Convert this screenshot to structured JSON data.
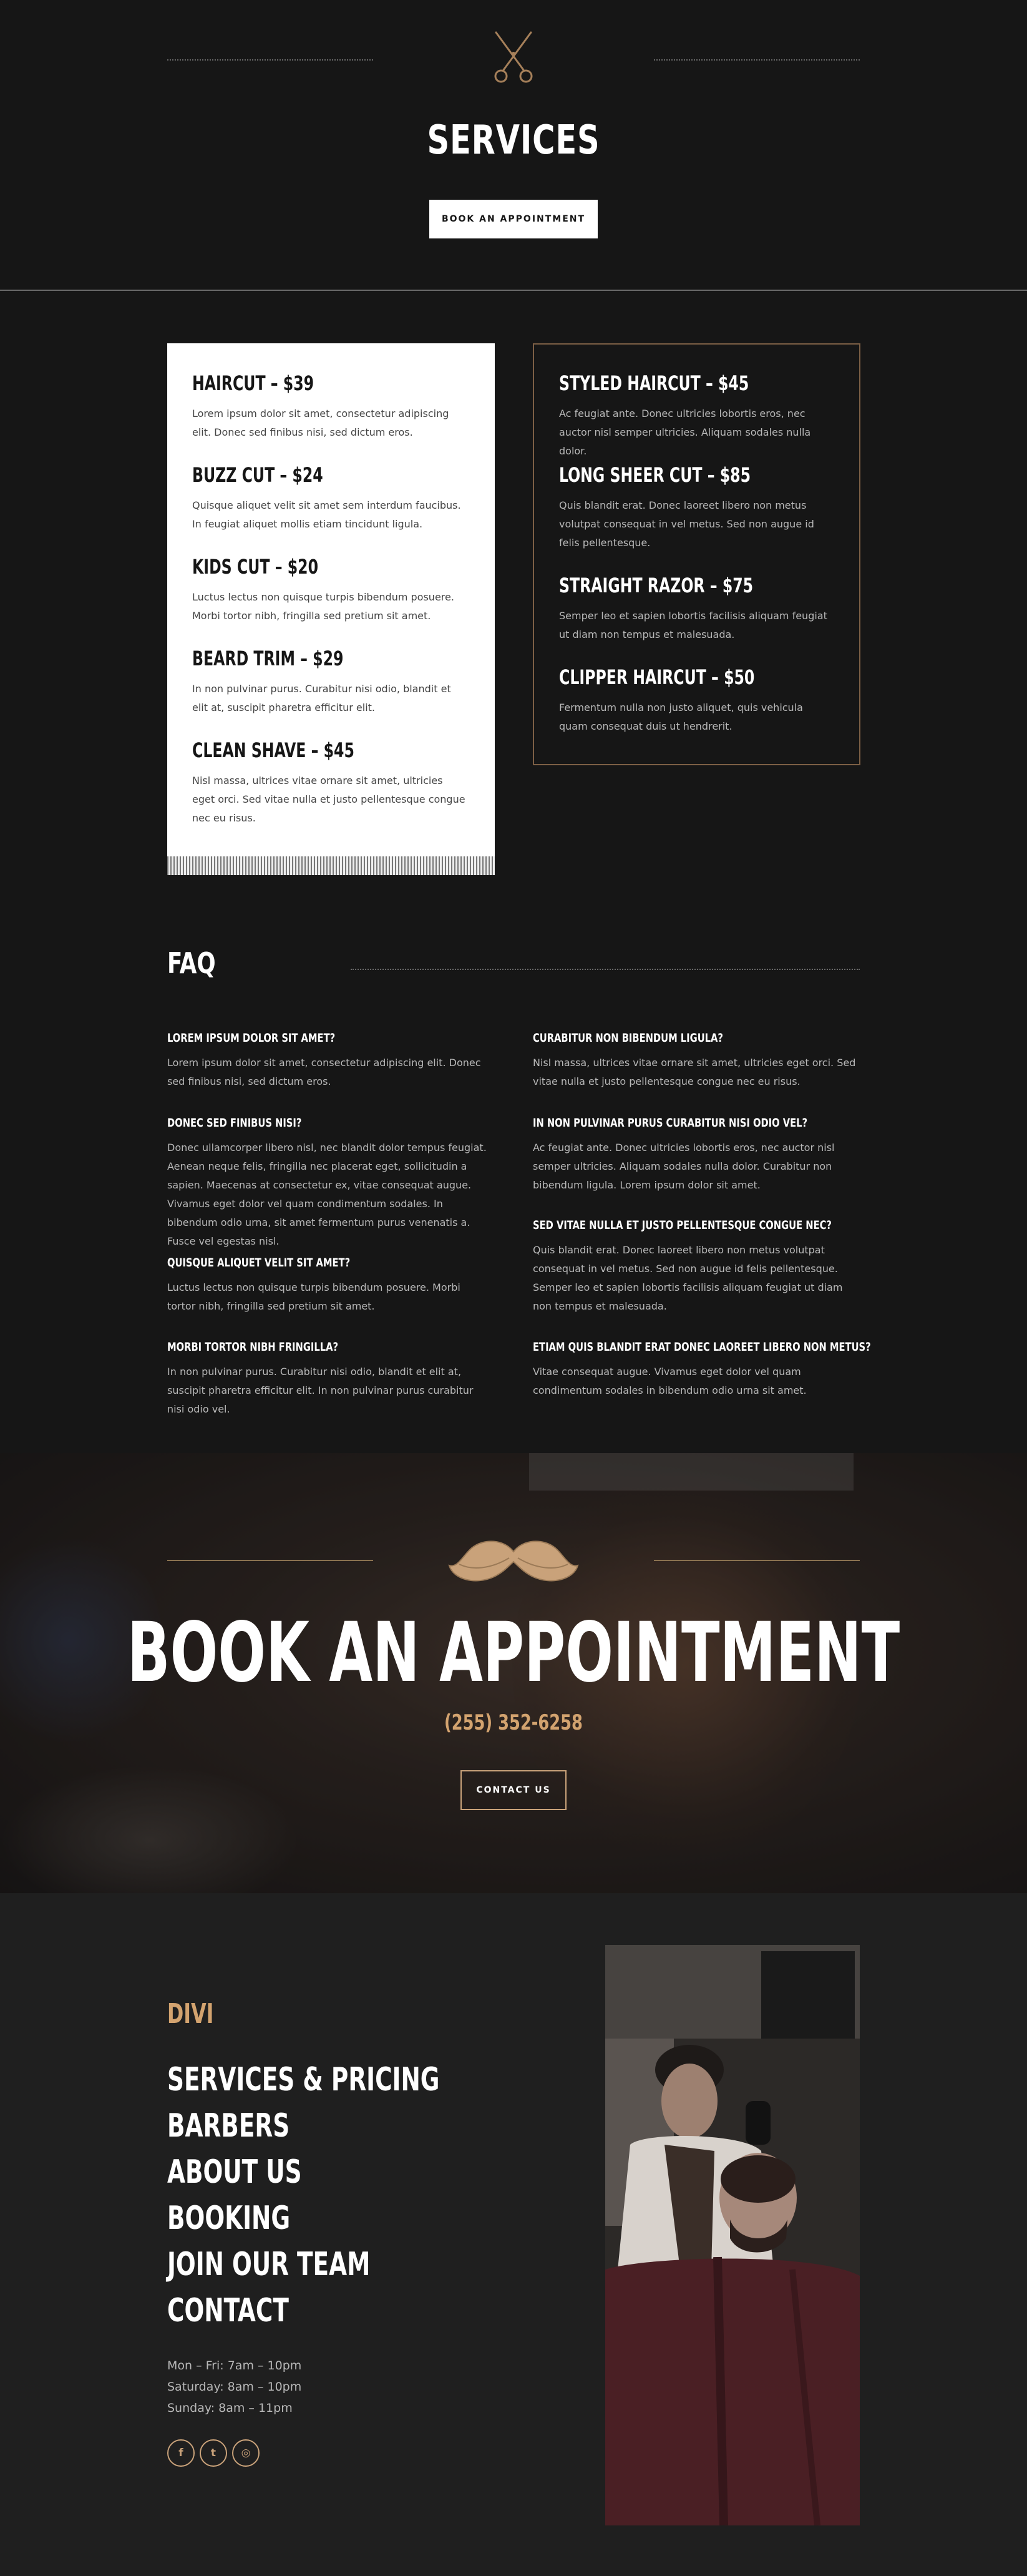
{
  "hero": {
    "title": "SERVICES",
    "button_label": "BOOK AN APPOINTMENT",
    "icon": "scissors-icon"
  },
  "services_left": [
    {
      "name": "HAIRCUT – $39",
      "description": "Lorem ipsum dolor sit amet, consectetur adipiscing elit. Donec sed finibus nisi, sed dictum eros."
    },
    {
      "name": "BUZZ CUT – $24",
      "description": "Quisque aliquet velit sit amet sem interdum faucibus. In feugiat aliquet mollis etiam tincidunt ligula."
    },
    {
      "name": "KIDS CUT – $20",
      "description": "Luctus lectus non quisque turpis bibendum posuere. Morbi tortor nibh, fringilla sed pretium sit amet."
    },
    {
      "name": "BEARD TRIM – $29",
      "description": "In non pulvinar purus. Curabitur nisi odio, blandit et elit at, suscipit pharetra efficitur elit."
    },
    {
      "name": "CLEAN SHAVE – $45",
      "description": "Nisl massa, ultrices vitae ornare sit amet, ultricies eget orci. Sed vitae nulla et justo pellentesque congue nec eu risus."
    }
  ],
  "services_right": [
    {
      "name": "STYLED HAIRCUT – $45",
      "description": "Ac feugiat ante. Donec ultricies lobortis eros, nec auctor nisl semper ultricies. Aliquam sodales nulla dolor."
    },
    {
      "name": "LONG SHEER CUT – $85",
      "description": "Quis blandit erat. Donec laoreet libero non metus volutpat consequat in vel metus. Sed non augue id felis pellentesque."
    },
    {
      "name": "STRAIGHT RAZOR – $75",
      "description": "Semper leo et sapien lobortis facilisis aliquam feugiat ut diam non tempus et malesuada."
    },
    {
      "name": "CLIPPER HAIRCUT – $50",
      "description": "Fermentum nulla non justo aliquet, quis vehicula quam consequat duis ut hendrerit."
    }
  ],
  "faq": {
    "title": "FAQ",
    "left": [
      {
        "q": "LOREM IPSUM DOLOR SIT AMET?",
        "a": "Lorem ipsum dolor sit amet, consectetur adipiscing elit. Donec sed finibus nisi, sed dictum eros."
      },
      {
        "q": "DONEC SED FINIBUS NISI?",
        "a": "Donec ullamcorper libero nisl, nec blandit dolor tempus feugiat. Aenean neque felis, fringilla nec placerat eget, sollicitudin a sapien. Maecenas at consectetur ex, vitae consequat augue. Vivamus eget dolor vel quam condimentum sodales. In bibendum odio urna, sit amet fermentum purus venenatis a. Fusce vel egestas nisl."
      },
      {
        "q": "QUISQUE ALIQUET VELIT SIT AMET?",
        "a": "Luctus lectus non quisque turpis bibendum posuere. Morbi tortor nibh, fringilla sed pretium sit amet."
      },
      {
        "q": "MORBI TORTOR NIBH FRINGILLA?",
        "a": "In non pulvinar purus. Curabitur nisi odio, blandit et elit at, suscipit pharetra efficitur elit. In non pulvinar purus curabitur nisi odio vel."
      }
    ],
    "right": [
      {
        "q": "CURABITUR NON BIBENDUM LIGULA?",
        "a": "Nisl massa, ultrices vitae ornare sit amet, ultricies eget orci. Sed vitae nulla et justo pellentesque congue nec eu risus."
      },
      {
        "q": "IN NON PULVINAR PURUS CURABITUR NISI ODIO VEL?",
        "a": "Ac feugiat ante. Donec ultricies lobortis eros, nec auctor nisl semper ultricies. Aliquam sodales nulla dolor. Curabitur non bibendum ligula. Lorem ipsum dolor sit amet."
      },
      {
        "q": "SED VITAE NULLA ET JUSTO PELLENTESQUE CONGUE NEC?",
        "a": "Quis blandit erat. Donec laoreet libero non metus volutpat consequat in vel metus. Sed non augue id felis pellentesque. Semper leo et sapien lobortis facilisis aliquam feugiat ut diam non tempus et malesuada."
      },
      {
        "q": "ETIAM QUIS BLANDIT ERAT DONEC LAOREET LIBERO NON METUS?",
        "a": "Vitae consequat augue. Vivamus eget dolor vel quam condimentum sodales in bibendum odio urna sit amet."
      }
    ]
  },
  "book": {
    "title": "BOOK AN APPOINTMENT",
    "phone": "(255) 352-6258",
    "button_label": "CONTACT US",
    "icon": "mustache-icon"
  },
  "footer": {
    "brand": "DIVI",
    "nav": [
      "SERVICES & PRICING",
      "BARBERS",
      "ABOUT US",
      "BOOKING",
      "JOIN OUR TEAM",
      "CONTACT"
    ],
    "hours": [
      "Mon – Fri: 7am – 10pm",
      "Saturday: 8am – 10pm",
      "Sunday: 8am – 11pm"
    ],
    "socials": [
      {
        "icon": "facebook-icon",
        "glyph": "f"
      },
      {
        "icon": "twitter-icon",
        "glyph": "t"
      },
      {
        "icon": "instagram-icon",
        "glyph": "◎"
      }
    ]
  },
  "colors": {
    "background": "#161616",
    "footer_background": "#1f1f1f",
    "accent_gold": "#d3a36f",
    "border_bronze": "#7c5f45"
  }
}
